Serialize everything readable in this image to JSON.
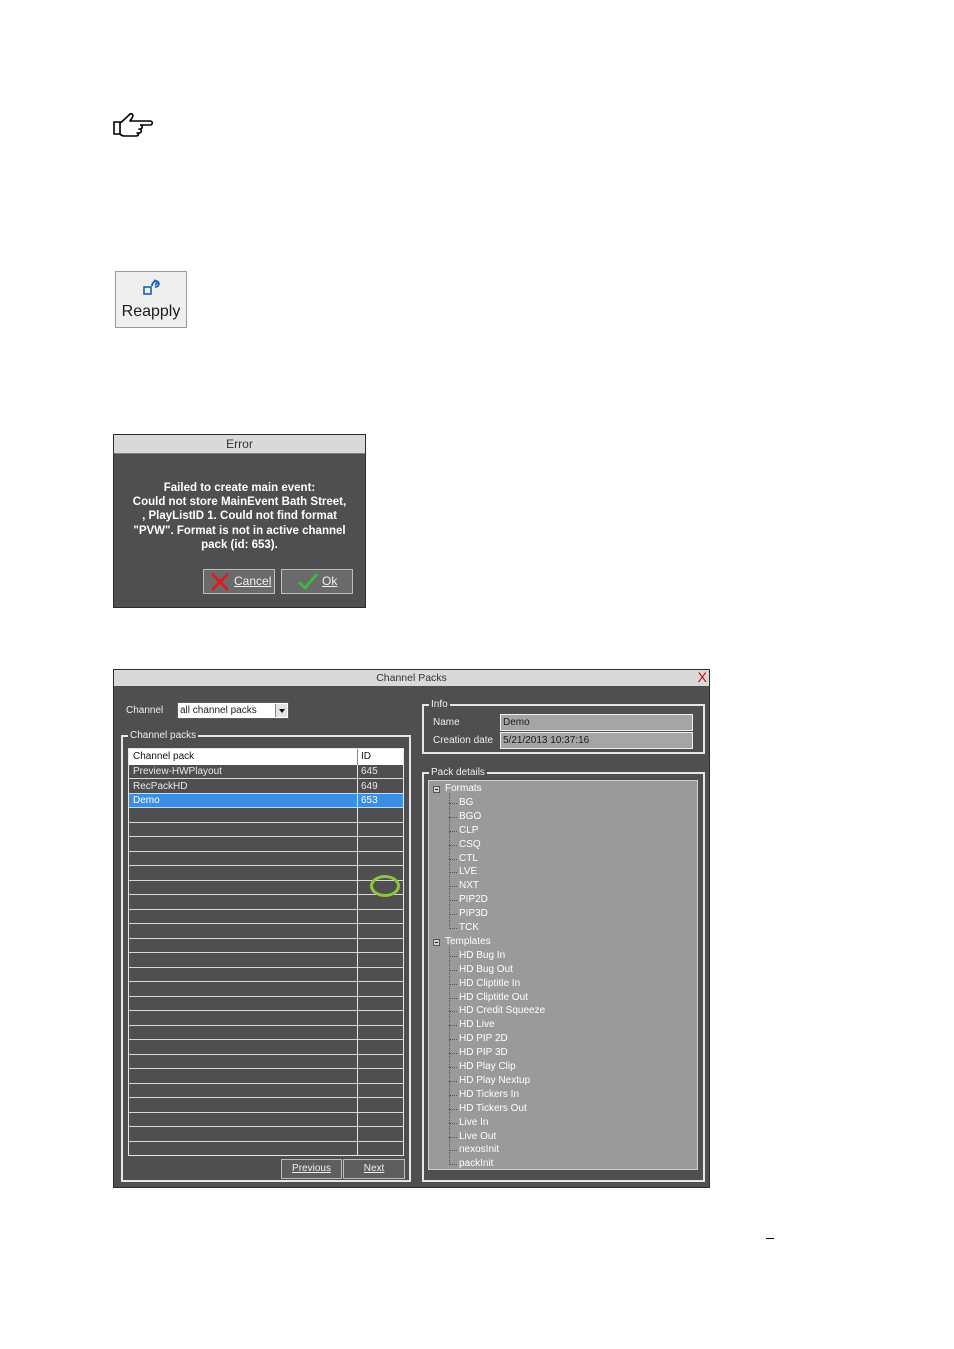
{
  "reapply": {
    "label": "Reapply"
  },
  "error_dialog": {
    "title": "Error",
    "message_lines": [
      "Failed to create main event:",
      "Could not store MainEvent Bath Street,",
      ", PlayListID 1. Could not find format",
      "\"PVW\". Format is not in active channel",
      "pack (id: 653)."
    ],
    "cancel_label": "Cancel",
    "ok_label": "Ok"
  },
  "channel_packs": {
    "title": "Channel Packs",
    "close_label": "X",
    "channel_label": "Channel",
    "channel_value": "all channel packs",
    "packs_group": "Channel packs",
    "columns": [
      "Channel pack",
      "ID"
    ],
    "rows": [
      {
        "name": "Preview-HWPlayout",
        "id": "645"
      },
      {
        "name": "RecPackHD",
        "id": "649"
      },
      {
        "name": "Demo",
        "id": "653"
      }
    ],
    "previous_label": "Previous",
    "next_label": "Next",
    "info_group": "Info",
    "name_label": "Name",
    "name_value": "Demo",
    "date_label": "Creation date",
    "date_value": "5/21/2013 10:37:16",
    "details_group": "Pack details",
    "formats_label": "Formats",
    "formats": [
      "BG",
      "BGO",
      "CLP",
      "CSQ",
      "CTL",
      "LVE",
      "NXT",
      "PIP2D",
      "PIP3D",
      "TCK"
    ],
    "templates_label": "Templates",
    "templates": [
      "HD Bug In",
      "HD Bug Out",
      "HD Cliptitle In",
      "HD Cliptitle Out",
      "HD Credit Squeeze",
      "HD Live",
      "HD PIP 2D",
      "HD PIP 3D",
      "HD Play Clip",
      "HD Play Nextup",
      "HD Tickers In",
      "HD Tickers Out",
      "Live In",
      "Live Out",
      "nexosInit",
      "packInit"
    ]
  }
}
